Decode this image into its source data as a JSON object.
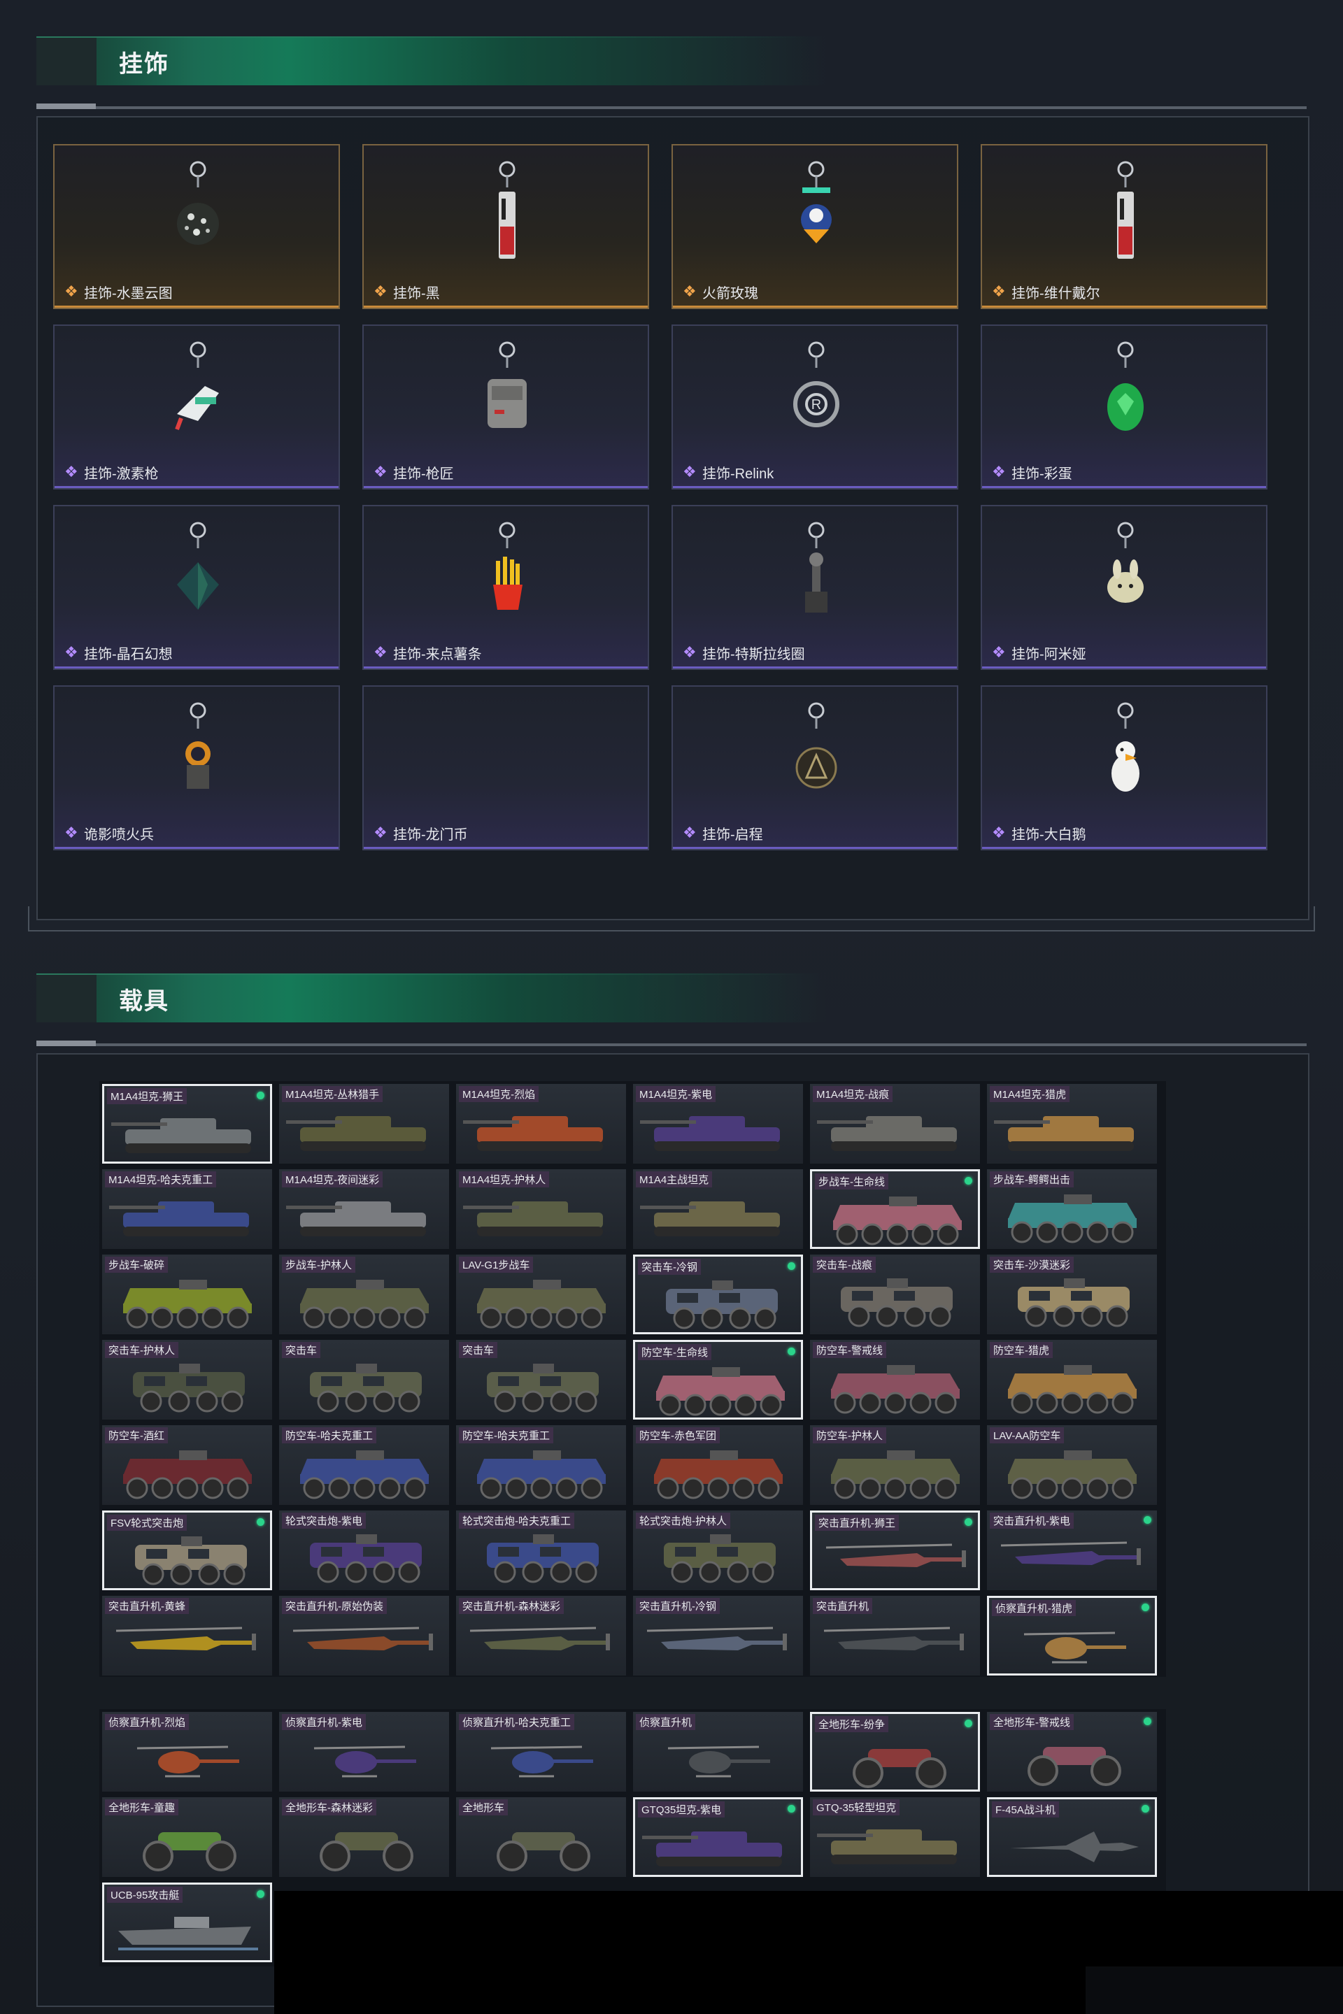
{
  "sections": {
    "charms": {
      "title": "挂饰"
    },
    "vehicles": {
      "title": "载具"
    }
  },
  "charms": [
    {
      "name": "挂饰-水墨云图",
      "rarity": "gold",
      "icon": "ball-charm-icon"
    },
    {
      "name": "挂饰-黑",
      "rarity": "gold",
      "icon": "tag-charm-icon"
    },
    {
      "name": "火箭玫瑰",
      "rarity": "gold",
      "icon": "rocket-rose-charm-icon"
    },
    {
      "name": "挂饰-维什戴尔",
      "rarity": "gold",
      "icon": "tag-charm-icon"
    },
    {
      "name": "挂饰-激素枪",
      "rarity": "purple",
      "icon": "gun-charm-icon"
    },
    {
      "name": "挂饰-枪匠",
      "rarity": "purple",
      "icon": "bag-charm-icon"
    },
    {
      "name": "挂饰-Relink",
      "rarity": "purple",
      "icon": "relink-charm-icon"
    },
    {
      "name": "挂饰-彩蛋",
      "rarity": "purple",
      "icon": "egg-charm-icon"
    },
    {
      "name": "挂饰-晶石幻想",
      "rarity": "purple",
      "icon": "crystal-charm-icon"
    },
    {
      "name": "挂饰-来点薯条",
      "rarity": "purple",
      "icon": "fries-charm-icon"
    },
    {
      "name": "挂饰-特斯拉线圈",
      "rarity": "purple",
      "icon": "tesla-coil-charm-icon"
    },
    {
      "name": "挂饰-阿米娅",
      "rarity": "purple",
      "icon": "bunny-charm-icon"
    },
    {
      "name": "诡影喷火兵",
      "rarity": "purple",
      "icon": "flamer-charm-icon"
    },
    {
      "name": "挂饰-龙门币",
      "rarity": "purple",
      "icon": "coin-charm-icon"
    },
    {
      "name": "挂饰-启程",
      "rarity": "purple",
      "icon": "medal-charm-icon"
    },
    {
      "name": "挂饰-大白鹅",
      "rarity": "purple",
      "icon": "goose-charm-icon"
    }
  ],
  "vehicles": [
    {
      "name": "M1A4坦克-狮王",
      "kind": "tank",
      "selected": true,
      "dot": true,
      "color": "#6d7275"
    },
    {
      "name": "M1A4坦克-丛林猎手",
      "kind": "tank",
      "selected": false,
      "dot": false,
      "color": "#5a5a3a"
    },
    {
      "name": "M1A4坦克-烈焰",
      "kind": "tank",
      "selected": false,
      "dot": false,
      "color": "#a24a2a"
    },
    {
      "name": "M1A4坦克-紫电",
      "kind": "tank",
      "selected": false,
      "dot": false,
      "color": "#4a3a7a"
    },
    {
      "name": "M1A4坦克-战痕",
      "kind": "tank",
      "selected": false,
      "dot": false,
      "color": "#6a6a66"
    },
    {
      "name": "M1A4坦克-猎虎",
      "kind": "tank",
      "selected": false,
      "dot": false,
      "color": "#a07840"
    },
    {
      "name": "M1A4坦克-哈夫克重工",
      "kind": "tank",
      "selected": false,
      "dot": false,
      "color": "#3a4a8a"
    },
    {
      "name": "M1A4坦克-夜间迷彩",
      "kind": "tank",
      "selected": false,
      "dot": false,
      "color": "#7a7c80"
    },
    {
      "name": "M1A4坦克-护林人",
      "kind": "tank",
      "selected": false,
      "dot": false,
      "color": "#5a5e44"
    },
    {
      "name": "M1A4主战坦克",
      "kind": "tank",
      "selected": false,
      "dot": false,
      "color": "#6b6648"
    },
    {
      "name": "步战车-生命线",
      "kind": "apc",
      "selected": true,
      "dot": true,
      "color": "#a06070"
    },
    {
      "name": "步战车-鳄鳄出击",
      "kind": "apc",
      "selected": false,
      "dot": false,
      "color": "#3a8a8a"
    },
    {
      "name": "步战车-破碎",
      "kind": "apc",
      "selected": false,
      "dot": false,
      "color": "#7a8a2a"
    },
    {
      "name": "步战车-护林人",
      "kind": "apc",
      "selected": false,
      "dot": false,
      "color": "#5a5e44"
    },
    {
      "name": "LAV-G1步战车",
      "kind": "apc",
      "selected": false,
      "dot": false,
      "color": "#5e6046"
    },
    {
      "name": "突击车-冷钢",
      "kind": "truck",
      "selected": true,
      "dot": true,
      "color": "#5a6478"
    },
    {
      "name": "突击车-战痕",
      "kind": "truck",
      "selected": false,
      "dot": false,
      "color": "#6a6660"
    },
    {
      "name": "突击车-沙漠迷彩",
      "kind": "truck",
      "selected": false,
      "dot": false,
      "color": "#9a8a66"
    },
    {
      "name": "突击车-护林人",
      "kind": "truck",
      "selected": false,
      "dot": false,
      "color": "#4a5040"
    },
    {
      "name": "突击车",
      "kind": "truck",
      "selected": false,
      "dot": false,
      "color": "#5a5e4a"
    },
    {
      "name": "突击车",
      "kind": "truck",
      "selected": false,
      "dot": false,
      "color": "#5a5e4a"
    },
    {
      "name": "防空车-生命线",
      "kind": "apc",
      "selected": true,
      "dot": true,
      "color": "#a06070"
    },
    {
      "name": "防空车-警戒线",
      "kind": "apc",
      "selected": false,
      "dot": false,
      "color": "#8a5060"
    },
    {
      "name": "防空车-猎虎",
      "kind": "apc",
      "selected": false,
      "dot": false,
      "color": "#a07840"
    },
    {
      "name": "防空车-酒红",
      "kind": "apc",
      "selected": false,
      "dot": false,
      "color": "#6a2a30"
    },
    {
      "name": "防空车-哈夫克重工",
      "kind": "apc",
      "selected": false,
      "dot": false,
      "color": "#3a4a8a"
    },
    {
      "name": "防空车-哈夫克重工",
      "kind": "apc",
      "selected": false,
      "dot": false,
      "color": "#3a4a8a"
    },
    {
      "name": "防空车-赤色军团",
      "kind": "apc",
      "selected": false,
      "dot": false,
      "color": "#8a3a2a"
    },
    {
      "name": "防空车-护林人",
      "kind": "apc",
      "selected": false,
      "dot": false,
      "color": "#5a5e44"
    },
    {
      "name": "LAV-AA防空车",
      "kind": "apc",
      "selected": false,
      "dot": false,
      "color": "#5e6046"
    },
    {
      "name": "FSV轮式突击炮",
      "kind": "truck",
      "selected": true,
      "dot": true,
      "color": "#8a8270"
    },
    {
      "name": "轮式突击炮-紫电",
      "kind": "truck",
      "selected": false,
      "dot": false,
      "color": "#4a3a7a"
    },
    {
      "name": "轮式突击炮-哈夫克重工",
      "kind": "truck",
      "selected": false,
      "dot": false,
      "color": "#3a4a8a"
    },
    {
      "name": "轮式突击炮-护林人",
      "kind": "truck",
      "selected": false,
      "dot": false,
      "color": "#5a5e44"
    },
    {
      "name": "突击直升机-狮王",
      "kind": "heli",
      "selected": true,
      "dot": true,
      "color": "#8a4a4a"
    },
    {
      "name": "突击直升机-紫电",
      "kind": "heli",
      "selected": false,
      "dot": true,
      "color": "#4a3a7a"
    },
    {
      "name": "突击直升机-黄蜂",
      "kind": "heli",
      "selected": false,
      "dot": false,
      "color": "#b09020"
    },
    {
      "name": "突击直升机-原始伪装",
      "kind": "heli",
      "selected": false,
      "dot": false,
      "color": "#8a4a2a"
    },
    {
      "name": "突击直升机-森林迷彩",
      "kind": "heli",
      "selected": false,
      "dot": false,
      "color": "#5a5e44"
    },
    {
      "name": "突击直升机-冷钢",
      "kind": "heli",
      "selected": false,
      "dot": false,
      "color": "#5a6478"
    },
    {
      "name": "突击直升机",
      "kind": "heli",
      "selected": false,
      "dot": false,
      "color": "#4a4e52"
    },
    {
      "name": "侦察直升机-猎虎",
      "kind": "smallheli",
      "selected": true,
      "dot": true,
      "color": "#a07840"
    }
  ],
  "vehicles2": [
    {
      "name": "侦察直升机-烈焰",
      "kind": "smallheli",
      "selected": false,
      "dot": false,
      "color": "#a24a2a"
    },
    {
      "name": "侦察直升机-紫电",
      "kind": "smallheli",
      "selected": false,
      "dot": false,
      "color": "#4a3a7a"
    },
    {
      "name": "侦察直升机-哈夫克重工",
      "kind": "smallheli",
      "selected": false,
      "dot": false,
      "color": "#3a4a8a"
    },
    {
      "name": "侦察直升机",
      "kind": "smallheli",
      "selected": false,
      "dot": false,
      "color": "#4a4e52"
    },
    {
      "name": "全地形车-纷争",
      "kind": "atv",
      "selected": true,
      "dot": true,
      "color": "#8a3a3a"
    },
    {
      "name": "全地形车-警戒线",
      "kind": "atv",
      "selected": false,
      "dot": true,
      "color": "#8a5060"
    },
    {
      "name": "全地形车-童趣",
      "kind": "atv",
      "selected": false,
      "dot": false,
      "color": "#5a8a3a"
    },
    {
      "name": "全地形车-森林迷彩",
      "kind": "atv",
      "selected": false,
      "dot": false,
      "color": "#5a5e44"
    },
    {
      "name": "全地形车",
      "kind": "atv",
      "selected": false,
      "dot": false,
      "color": "#5a5e4a"
    },
    {
      "name": "GTQ35坦克-紫电",
      "kind": "tank",
      "selected": true,
      "dot": true,
      "color": "#4a3a7a"
    },
    {
      "name": "GTQ-35轻型坦克",
      "kind": "tank",
      "selected": false,
      "dot": false,
      "color": "#6b6648"
    },
    {
      "name": "F-45A战斗机",
      "kind": "jet",
      "selected": true,
      "dot": true,
      "color": "#5a5e62"
    },
    {
      "name": "UCB-95攻击艇",
      "kind": "boat",
      "selected": true,
      "dot": true,
      "color": "#6a6e72"
    }
  ]
}
